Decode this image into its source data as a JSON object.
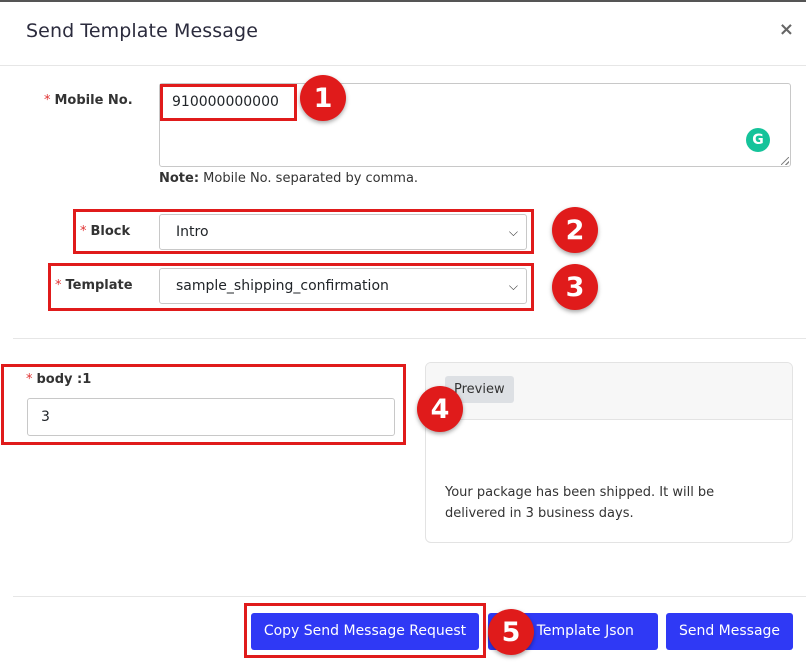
{
  "modal": {
    "title": "Send Template Message",
    "close_label": "×"
  },
  "form": {
    "required_mark": "*",
    "mobile_label": "Mobile No.",
    "mobile_value": "910000000000",
    "note_bold": "Note:",
    "note_text": " Mobile No. separated by comma.",
    "block_label": "Block",
    "block_value": "Intro",
    "template_label": "Template",
    "template_value": "sample_shipping_confirmation",
    "body_label": "body :1",
    "body_value": "3"
  },
  "preview": {
    "tab_label": "Preview",
    "text": "Your package has been shipped. It will be delivered in 3 business days."
  },
  "buttons": {
    "copy_request": "Copy Send Message Request",
    "copy_template_json": "y Template Json",
    "send_message": "Send Message"
  },
  "icons": {
    "close": "close-icon",
    "grammarly": "grammarly-icon",
    "dropdown": "chevron-down-icon"
  },
  "annotations": [
    "1",
    "2",
    "3",
    "4",
    "5"
  ],
  "colors": {
    "primary_button": "#2f39f5",
    "annotation_red": "#e01b1b",
    "required_red": "#e03131",
    "grammarly_green": "#15c39a"
  }
}
